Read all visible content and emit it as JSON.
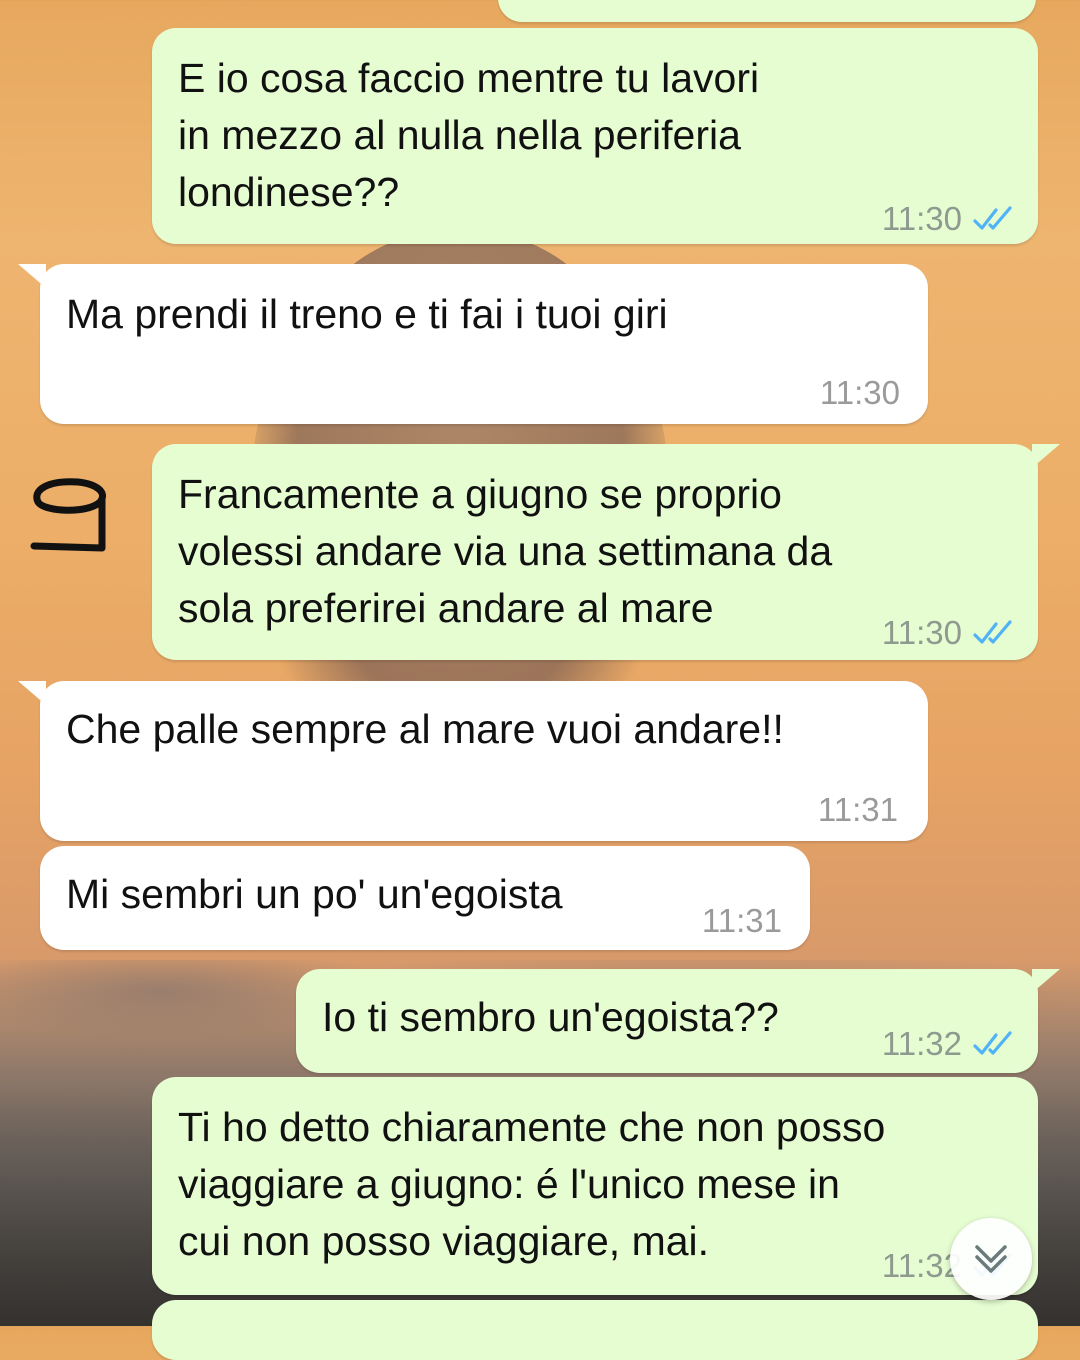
{
  "chat": {
    "messages": [
      {
        "direction": "outgoing",
        "text": "E io cosa faccio mentre tu lavori\nin mezzo al nulla nella periferia\nlondinese??",
        "time": "11:30",
        "status": "read"
      },
      {
        "direction": "incoming",
        "text": "Ma prendi il treno e ti fai i tuoi giri",
        "time": "11:30"
      },
      {
        "direction": "outgoing",
        "text": "Francamente a giugno se proprio\nvolessi andare via una settimana da\nsola preferirei andare al mare",
        "time": "11:30",
        "status": "read"
      },
      {
        "direction": "incoming",
        "text": "Che palle sempre al mare vuoi andare!!",
        "time": "11:31"
      },
      {
        "direction": "incoming",
        "text": "Mi sembri un po' un'egoista",
        "time": "11:31"
      },
      {
        "direction": "outgoing",
        "text": "Io ti sembro un'egoista??",
        "time": "11:32",
        "status": "read"
      },
      {
        "direction": "outgoing",
        "text": "Ti ho detto chiaramente che non posso\nviaggiare a giugno: é l'unico mese in\ncui non posso viaggiare, mai.",
        "time": "11:32",
        "status": "read"
      }
    ]
  },
  "annotation": {
    "text": "9"
  },
  "icons": {
    "read_receipt": "double-check-icon",
    "scroll_down": "chevron-double-down-icon"
  },
  "colors": {
    "outgoing_bubble": "#e6fdd2",
    "incoming_bubble": "#ffffff",
    "read_tick": "#4fb3f6",
    "timestamp": "#8e9a8f"
  }
}
